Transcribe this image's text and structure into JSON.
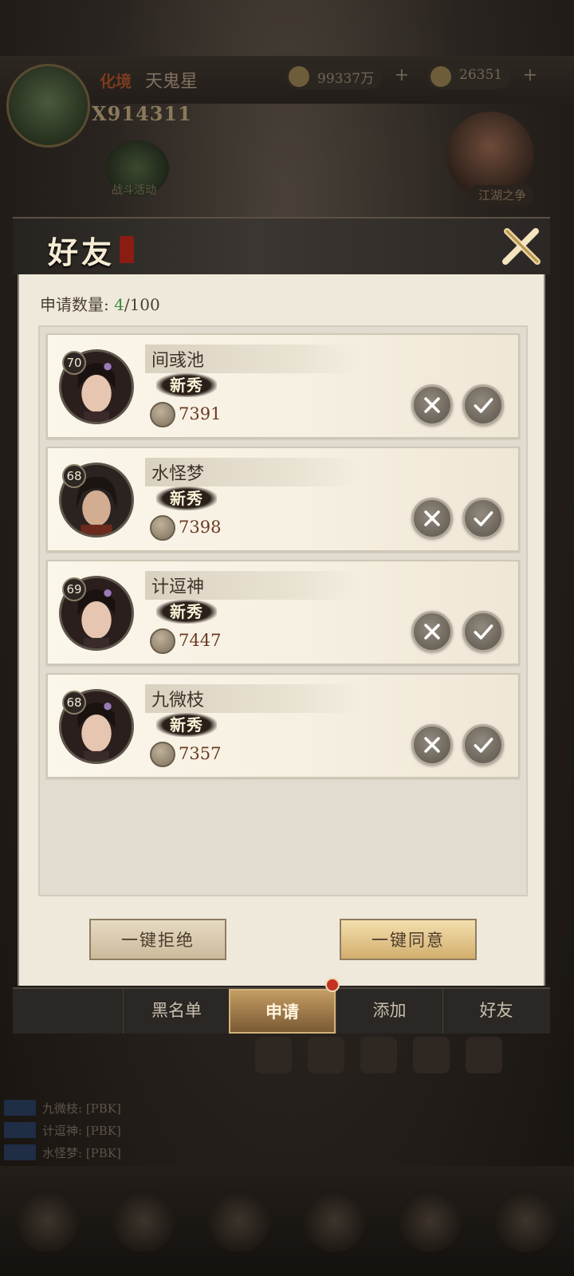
{
  "background": {
    "rank": "化境",
    "title": "天鬼星",
    "power": "X914311",
    "currency1": "99337万",
    "currency2": "26351",
    "hero_label": "江湖之争",
    "mid_label": "战斗活动",
    "chat": [
      {
        "text": "九微枝: [PBK]"
      },
      {
        "text": "计逗神: [PBK]"
      },
      {
        "text": "水怪梦: [PBK]"
      }
    ]
  },
  "dialog": {
    "title": "好友",
    "close_icon": "close-x-icon",
    "count_label": "申请数量: ",
    "count_current": "4",
    "count_total": "/100",
    "requests": [
      {
        "level": "70",
        "name": "间彧池",
        "badge": "新秀",
        "power": "7391",
        "gender": "female"
      },
      {
        "level": "68",
        "name": "水怪梦",
        "badge": "新秀",
        "power": "7398",
        "gender": "male"
      },
      {
        "level": "69",
        "name": "计逗神",
        "badge": "新秀",
        "power": "7447",
        "gender": "female"
      },
      {
        "level": "68",
        "name": "九微枝",
        "badge": "新秀",
        "power": "7357",
        "gender": "female"
      }
    ],
    "reject_all": "一键拒绝",
    "accept_all": "一键同意",
    "tabs": [
      {
        "label": "黑名单"
      },
      {
        "label": "申请",
        "active": true
      },
      {
        "label": "添加"
      },
      {
        "label": "好友"
      }
    ]
  },
  "colors": {
    "accent_gold": "#d2ae6d",
    "count_green": "#3c8c3c",
    "notify_red": "#c43224"
  }
}
